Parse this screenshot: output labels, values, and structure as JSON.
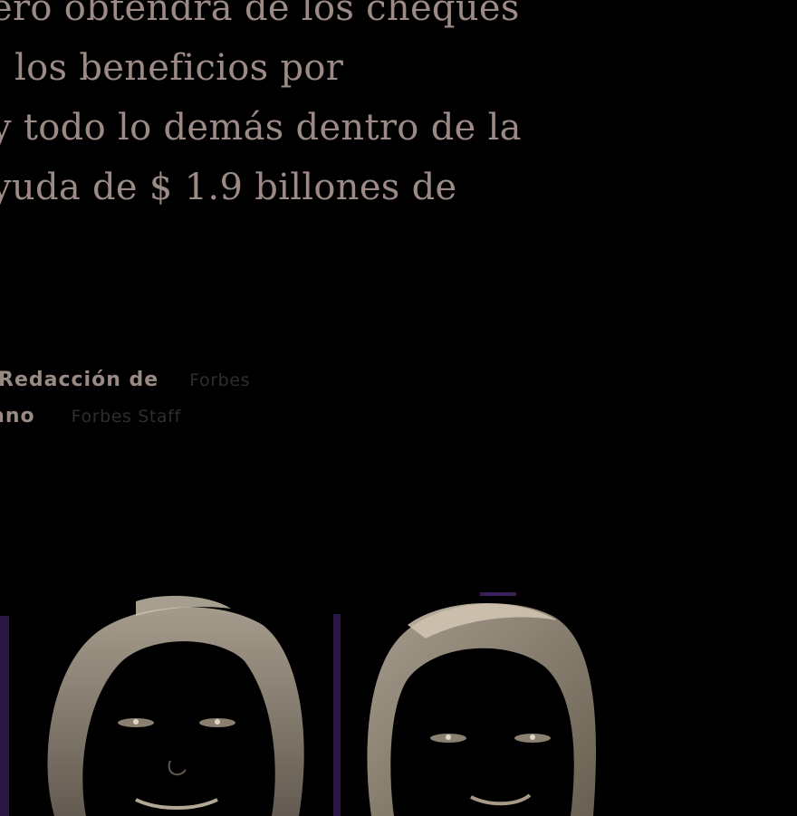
{
  "article": {
    "headline_lines": [
      "ero obtendrá de los cheques",
      ", los beneficios por",
      "y todo lo demás dentro de la",
      "yuda de $ 1.9 billones de"
    ]
  },
  "byline": [
    {
      "author": "Redacción de",
      "role": "Forbes"
    },
    {
      "author": "ano",
      "role": "Forbes Staff"
    }
  ],
  "colors": {
    "background": "#000000",
    "headline": "#9b8a85",
    "author": "#9a8a84",
    "role": "#2e2e2e",
    "accent_purple": "#3a1f5c"
  }
}
